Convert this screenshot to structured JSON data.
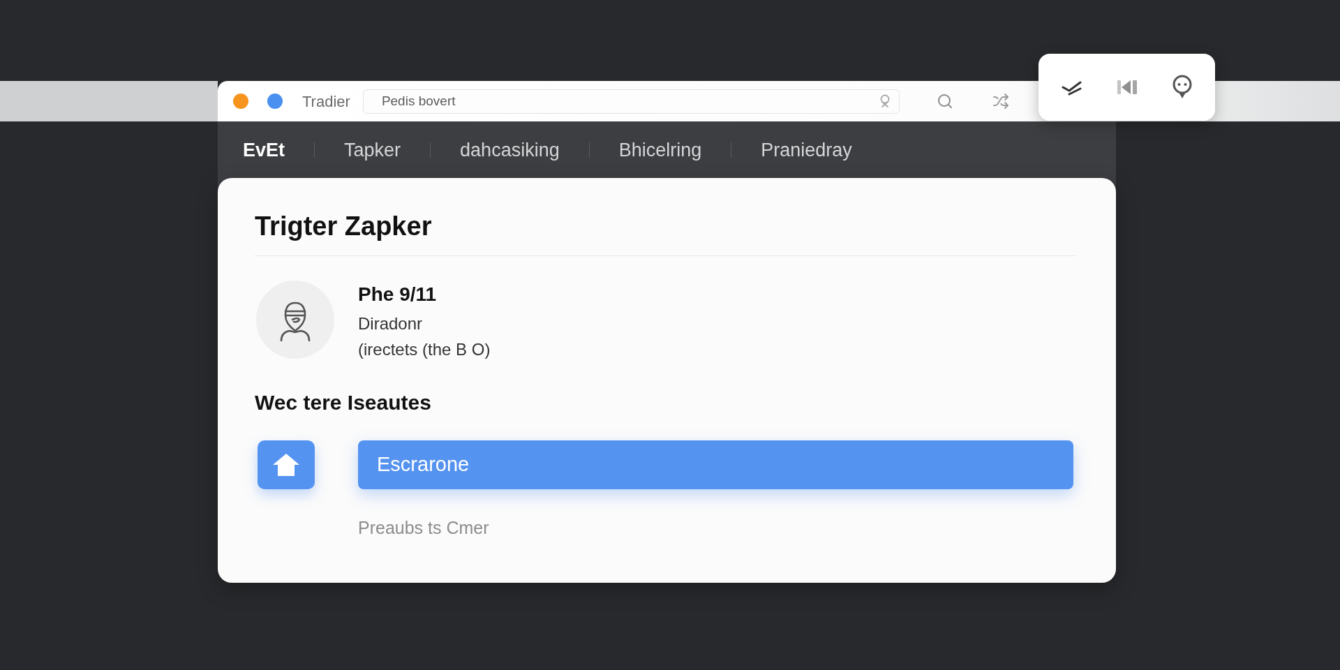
{
  "window": {
    "title": "Tradier",
    "controls": [
      {
        "color": "#f7941d"
      },
      {
        "color": "#4a90f0"
      }
    ]
  },
  "search": {
    "value": "Pedis bovert"
  },
  "nav": {
    "tabs": [
      {
        "label": "EvEt",
        "selected": true
      },
      {
        "label": "Tapker",
        "selected": false
      },
      {
        "label": "dahcasiking",
        "selected": false
      },
      {
        "label": "Bhicelring",
        "selected": false
      },
      {
        "label": "Praniedray",
        "selected": false
      }
    ]
  },
  "card": {
    "title": "Trigter Zapker",
    "profile": {
      "name": "Phe 9/11",
      "role": "Diradonr",
      "note": "(irectets (the B O)"
    },
    "section_title": "Wec tere Iseautes",
    "action": {
      "label": "Escrarone"
    },
    "hint": "Preaubs ts Cmer"
  }
}
